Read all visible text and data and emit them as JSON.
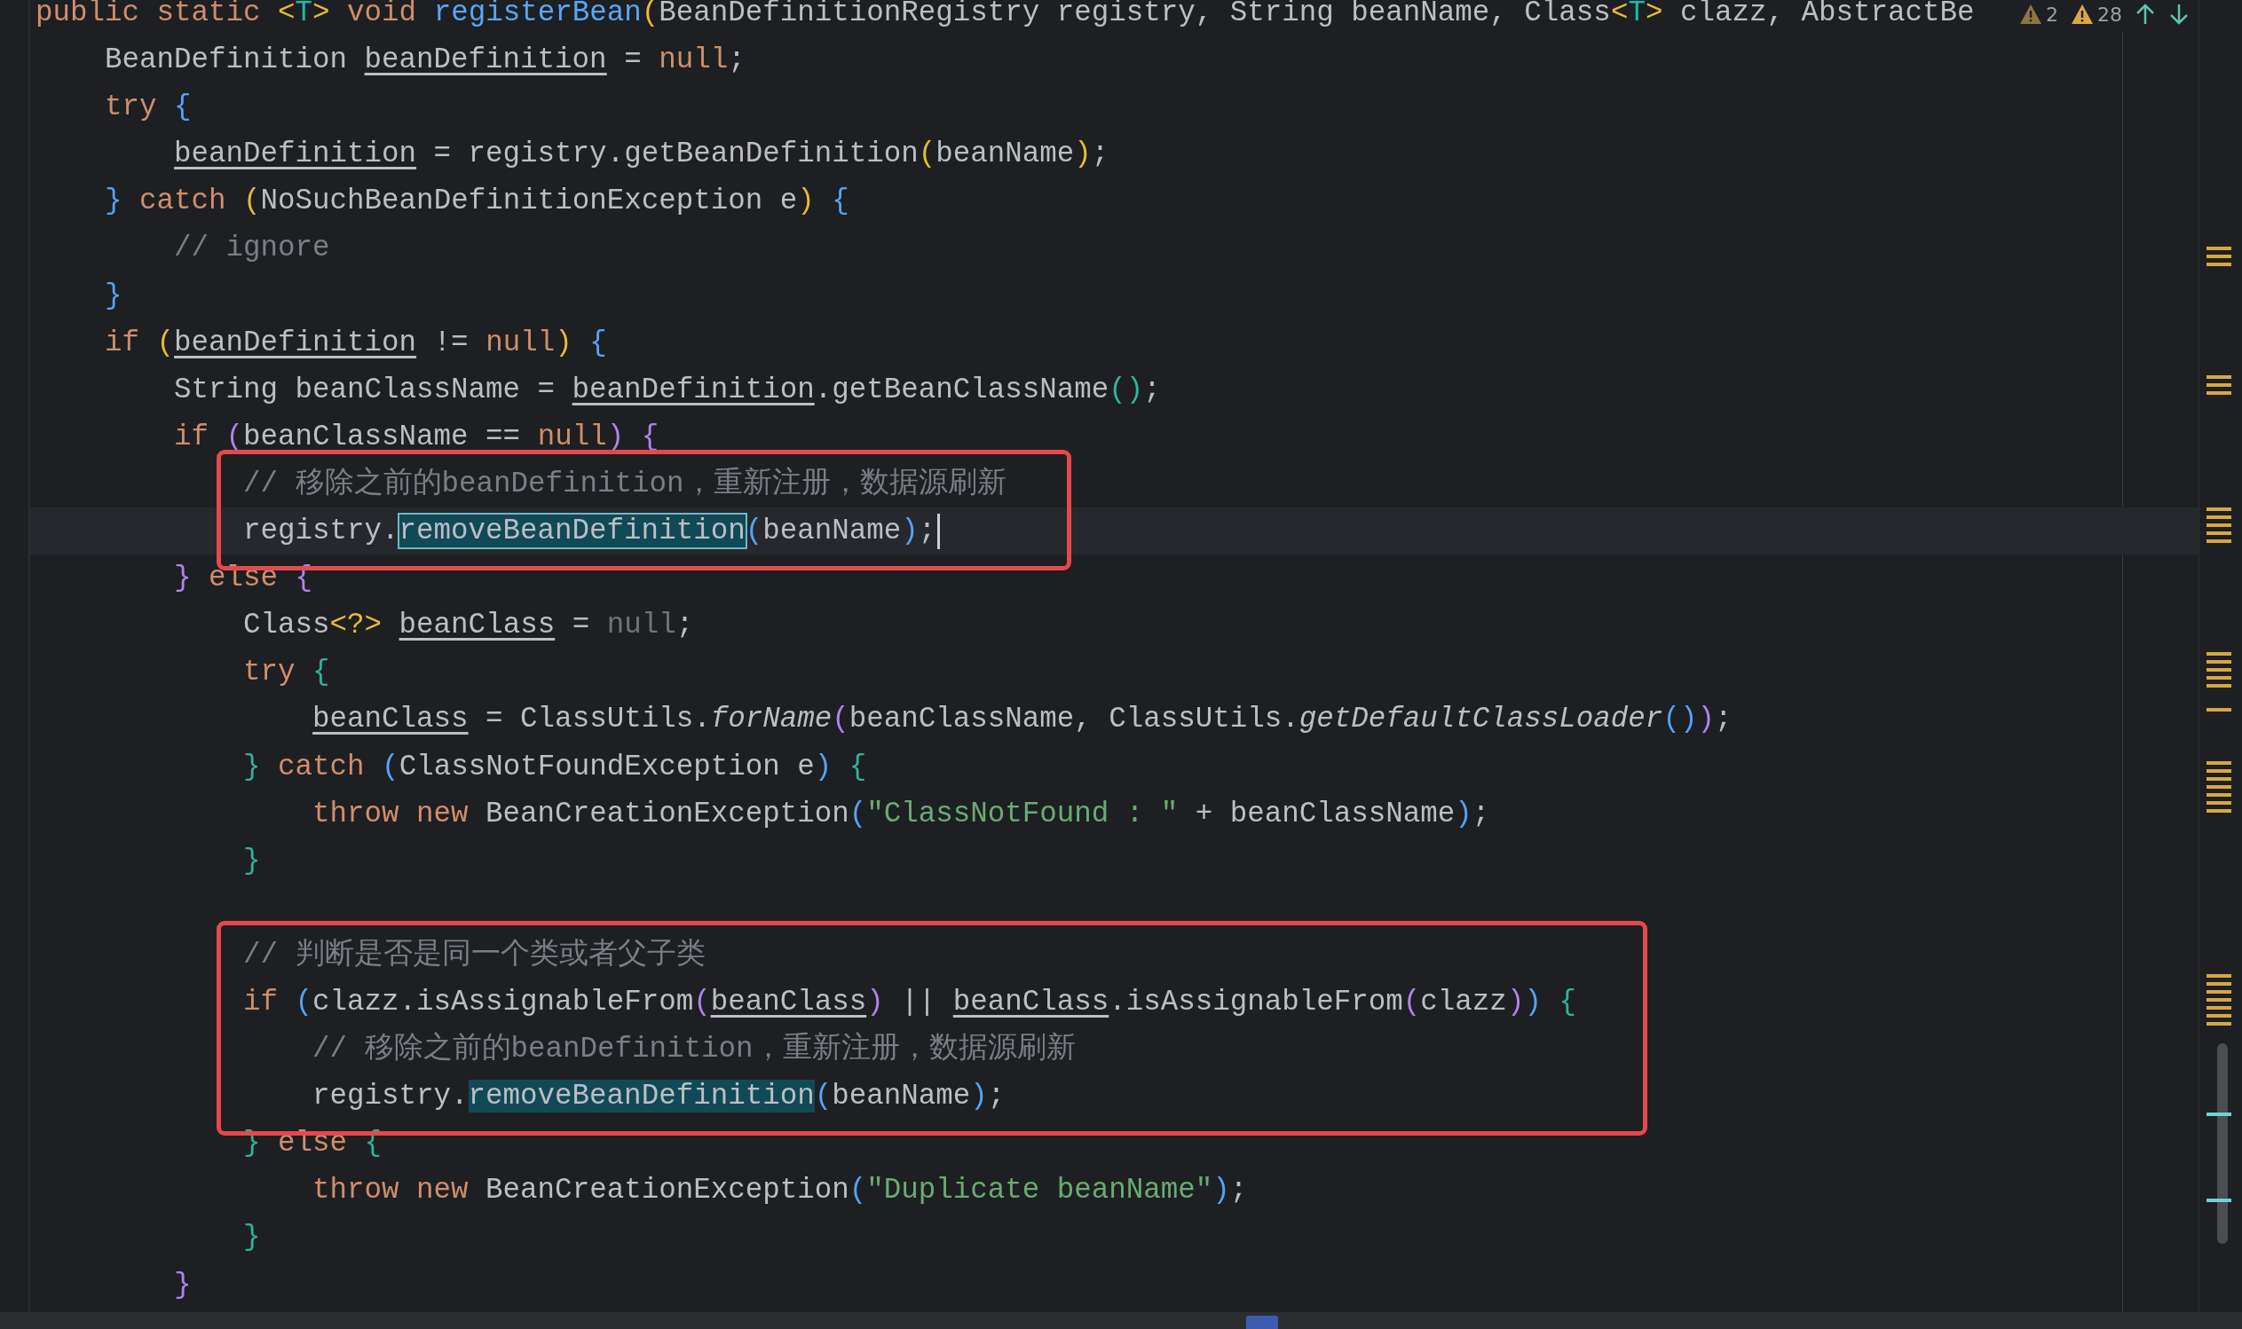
{
  "inspections": {
    "weak_warnings": "2",
    "warnings": "28"
  },
  "editor": {
    "lines": [
      {
        "kind": "code",
        "tokens": [
          {
            "kind": "keyword",
            "text": "public static "
          },
          {
            "kind": "bracket-a",
            "text": "<"
          },
          {
            "kind": "type-param",
            "text": "T"
          },
          {
            "kind": "bracket-a",
            "text": ">"
          },
          {
            "kind": "keyword",
            "text": " void "
          },
          {
            "kind": "declaration",
            "text": "registerBean"
          },
          {
            "kind": "bracket-a",
            "text": "("
          },
          {
            "kind": "plain",
            "text": "BeanDefinitionRegistry registry, String beanName, Class"
          },
          {
            "kind": "bracket-a",
            "text": "<"
          },
          {
            "kind": "type-param",
            "text": "T"
          },
          {
            "kind": "bracket-a",
            "text": ">"
          },
          {
            "kind": "plain",
            "text": " clazz, AbstractBe"
          }
        ]
      },
      {
        "kind": "code",
        "tokens": [
          {
            "kind": "plain",
            "text": "    BeanDefinition "
          },
          {
            "kind": "variable",
            "text": "beanDefinition"
          },
          {
            "kind": "plain",
            "text": " = "
          },
          {
            "kind": "keyword",
            "text": "null"
          },
          {
            "kind": "plain",
            "text": ";"
          }
        ]
      },
      {
        "kind": "code",
        "tokens": [
          {
            "kind": "keyword",
            "text": "    try "
          },
          {
            "kind": "bracket-b",
            "text": "{"
          }
        ]
      },
      {
        "kind": "code",
        "tokens": [
          {
            "kind": "variable",
            "text": "        beanDefinition"
          },
          {
            "kind": "plain",
            "text": " = registry.getBeanDefinition"
          },
          {
            "kind": "bracket-a",
            "text": "("
          },
          {
            "kind": "plain",
            "text": "beanName"
          },
          {
            "kind": "bracket-a",
            "text": ")"
          },
          {
            "kind": "plain",
            "text": ";"
          }
        ]
      },
      {
        "kind": "code",
        "tokens": [
          {
            "kind": "bracket-b",
            "text": "    }"
          },
          {
            "kind": "keyword",
            "text": " catch "
          },
          {
            "kind": "bracket-a",
            "text": "("
          },
          {
            "kind": "plain",
            "text": "NoSuchBeanDefinitionException e"
          },
          {
            "kind": "bracket-a",
            "text": ")"
          },
          {
            "kind": "bracket-b",
            "text": " {"
          }
        ]
      },
      {
        "kind": "code",
        "tokens": [
          {
            "kind": "comment",
            "text": "        // ignore"
          }
        ]
      },
      {
        "kind": "code",
        "tokens": [
          {
            "kind": "bracket-b",
            "text": "    }"
          }
        ]
      },
      {
        "kind": "code",
        "tokens": [
          {
            "kind": "keyword",
            "text": "    if "
          },
          {
            "kind": "bracket-a",
            "text": "("
          },
          {
            "kind": "variable",
            "text": "beanDefinition"
          },
          {
            "kind": "plain",
            "text": " != "
          },
          {
            "kind": "keyword",
            "text": "null"
          },
          {
            "kind": "bracket-a",
            "text": ")"
          },
          {
            "kind": "bracket-b",
            "text": " {"
          }
        ]
      },
      {
        "kind": "code",
        "tokens": [
          {
            "kind": "plain",
            "text": "        String beanClassName = "
          },
          {
            "kind": "variable",
            "text": "beanDefinition"
          },
          {
            "kind": "plain",
            "text": ".getBeanClassName"
          },
          {
            "kind": "bracket-c",
            "text": "()"
          },
          {
            "kind": "plain",
            "text": ";"
          }
        ]
      },
      {
        "kind": "code",
        "tokens": [
          {
            "kind": "keyword",
            "text": "        if "
          },
          {
            "kind": "bracket-d",
            "text": "("
          },
          {
            "kind": "plain",
            "text": "beanClassName == "
          },
          {
            "kind": "keyword",
            "text": "null"
          },
          {
            "kind": "bracket-d",
            "text": ")"
          },
          {
            "kind": "bracket-d",
            "text": " {"
          }
        ]
      },
      {
        "kind": "boxed",
        "lines": [
          {
            "kind": "code",
            "tokens": [
              {
                "kind": "comment",
                "text": "            // 移除之前的beanDefinition，重新注册，数据源刷新"
              }
            ]
          },
          {
            "kind": "code",
            "current": true,
            "caret": true,
            "tokens": [
              {
                "kind": "plain",
                "text": "            registry."
              },
              {
                "kind": "match",
                "selected": true,
                "text": "removeBeanDefinition"
              },
              {
                "kind": "bracket-b",
                "text": "("
              },
              {
                "kind": "plain",
                "text": "beanName"
              },
              {
                "kind": "bracket-b",
                "text": ")"
              },
              {
                "kind": "plain",
                "text": ";"
              }
            ]
          }
        ]
      },
      {
        "kind": "code",
        "tokens": [
          {
            "kind": "bracket-d",
            "text": "        }"
          },
          {
            "kind": "keyword",
            "text": " else "
          },
          {
            "kind": "bracket-d",
            "text": "{"
          }
        ]
      },
      {
        "kind": "code",
        "tokens": [
          {
            "kind": "plain",
            "text": "            Class"
          },
          {
            "kind": "bracket-a",
            "text": "<?>"
          },
          {
            "kind": "variable",
            "text": " beanClass"
          },
          {
            "kind": "plain",
            "text": " = "
          },
          {
            "kind": "unused",
            "text": "null"
          },
          {
            "kind": "plain",
            "text": ";"
          }
        ]
      },
      {
        "kind": "code",
        "tokens": [
          {
            "kind": "keyword",
            "text": "            try "
          },
          {
            "kind": "bracket-c",
            "text": "{"
          }
        ]
      },
      {
        "kind": "code",
        "tokens": [
          {
            "kind": "variable",
            "text": "                beanClass"
          },
          {
            "kind": "plain",
            "text": " = ClassUtils."
          },
          {
            "kind": "static-call",
            "text": "forName"
          },
          {
            "kind": "bracket-d",
            "text": "("
          },
          {
            "kind": "plain",
            "text": "beanClassName, ClassUtils."
          },
          {
            "kind": "static-call",
            "text": "getDefaultClassLoader"
          },
          {
            "kind": "bracket-b",
            "text": "()"
          },
          {
            "kind": "bracket-d",
            "text": ")"
          },
          {
            "kind": "plain",
            "text": ";"
          }
        ]
      },
      {
        "kind": "code",
        "tokens": [
          {
            "kind": "bracket-c",
            "text": "            }"
          },
          {
            "kind": "keyword",
            "text": " catch "
          },
          {
            "kind": "bracket-b",
            "text": "("
          },
          {
            "kind": "plain",
            "text": "ClassNotFoundException e"
          },
          {
            "kind": "bracket-b",
            "text": ")"
          },
          {
            "kind": "bracket-c",
            "text": " {"
          }
        ]
      },
      {
        "kind": "code",
        "tokens": [
          {
            "kind": "keyword",
            "text": "                throw new "
          },
          {
            "kind": "plain",
            "text": "BeanCreationException"
          },
          {
            "kind": "bracket-b",
            "text": "("
          },
          {
            "kind": "string",
            "text": "\"ClassNotFound : \""
          },
          {
            "kind": "plain",
            "text": " + beanClassName"
          },
          {
            "kind": "bracket-b",
            "text": ")"
          },
          {
            "kind": "plain",
            "text": ";"
          }
        ]
      },
      {
        "kind": "code",
        "tokens": [
          {
            "kind": "bracket-c",
            "text": "            }"
          }
        ]
      },
      {
        "kind": "blank"
      },
      {
        "kind": "boxed",
        "lines": [
          {
            "kind": "code",
            "tokens": [
              {
                "kind": "comment",
                "text": "            // 判断是否是同一个类或者父子类"
              }
            ]
          },
          {
            "kind": "code",
            "tokens": [
              {
                "kind": "keyword",
                "text": "            if "
              },
              {
                "kind": "bracket-b",
                "text": "("
              },
              {
                "kind": "plain",
                "text": "clazz.isAssignableFrom"
              },
              {
                "kind": "bracket-d",
                "text": "("
              },
              {
                "kind": "variable",
                "text": "beanClass"
              },
              {
                "kind": "bracket-d",
                "text": ")"
              },
              {
                "kind": "plain",
                "text": " || "
              },
              {
                "kind": "variable",
                "text": "beanClass"
              },
              {
                "kind": "plain",
                "text": ".isAssignableFrom"
              },
              {
                "kind": "bracket-d",
                "text": "("
              },
              {
                "kind": "plain",
                "text": "clazz"
              },
              {
                "kind": "bracket-d",
                "text": ")"
              },
              {
                "kind": "bracket-b",
                "text": ")"
              },
              {
                "kind": "bracket-c",
                "text": " {"
              }
            ]
          },
          {
            "kind": "code",
            "tokens": [
              {
                "kind": "comment",
                "text": "                // 移除之前的beanDefinition，重新注册，数据源刷新"
              }
            ]
          },
          {
            "kind": "code",
            "tokens": [
              {
                "kind": "plain",
                "text": "                registry."
              },
              {
                "kind": "match",
                "selected": false,
                "text": "removeBeanDefinition"
              },
              {
                "kind": "bracket-b",
                "text": "("
              },
              {
                "kind": "plain",
                "text": "beanName"
              },
              {
                "kind": "bracket-b",
                "text": ")"
              },
              {
                "kind": "plain",
                "text": ";"
              }
            ]
          }
        ]
      },
      {
        "kind": "code",
        "tokens": [
          {
            "kind": "bracket-c",
            "text": "            }"
          },
          {
            "kind": "keyword",
            "text": " else "
          },
          {
            "kind": "bracket-c",
            "text": "{"
          }
        ]
      },
      {
        "kind": "code",
        "tokens": [
          {
            "kind": "keyword",
            "text": "                throw new "
          },
          {
            "kind": "plain",
            "text": "BeanCreationException"
          },
          {
            "kind": "bracket-b",
            "text": "("
          },
          {
            "kind": "string",
            "text": "\"Duplicate beanName\""
          },
          {
            "kind": "bracket-b",
            "text": ")"
          },
          {
            "kind": "plain",
            "text": ";"
          }
        ]
      },
      {
        "kind": "code",
        "tokens": [
          {
            "kind": "bracket-c",
            "text": "            }"
          }
        ]
      },
      {
        "kind": "code",
        "tokens": [
          {
            "kind": "bracket-d",
            "text": "        }"
          }
        ]
      }
    ]
  }
}
